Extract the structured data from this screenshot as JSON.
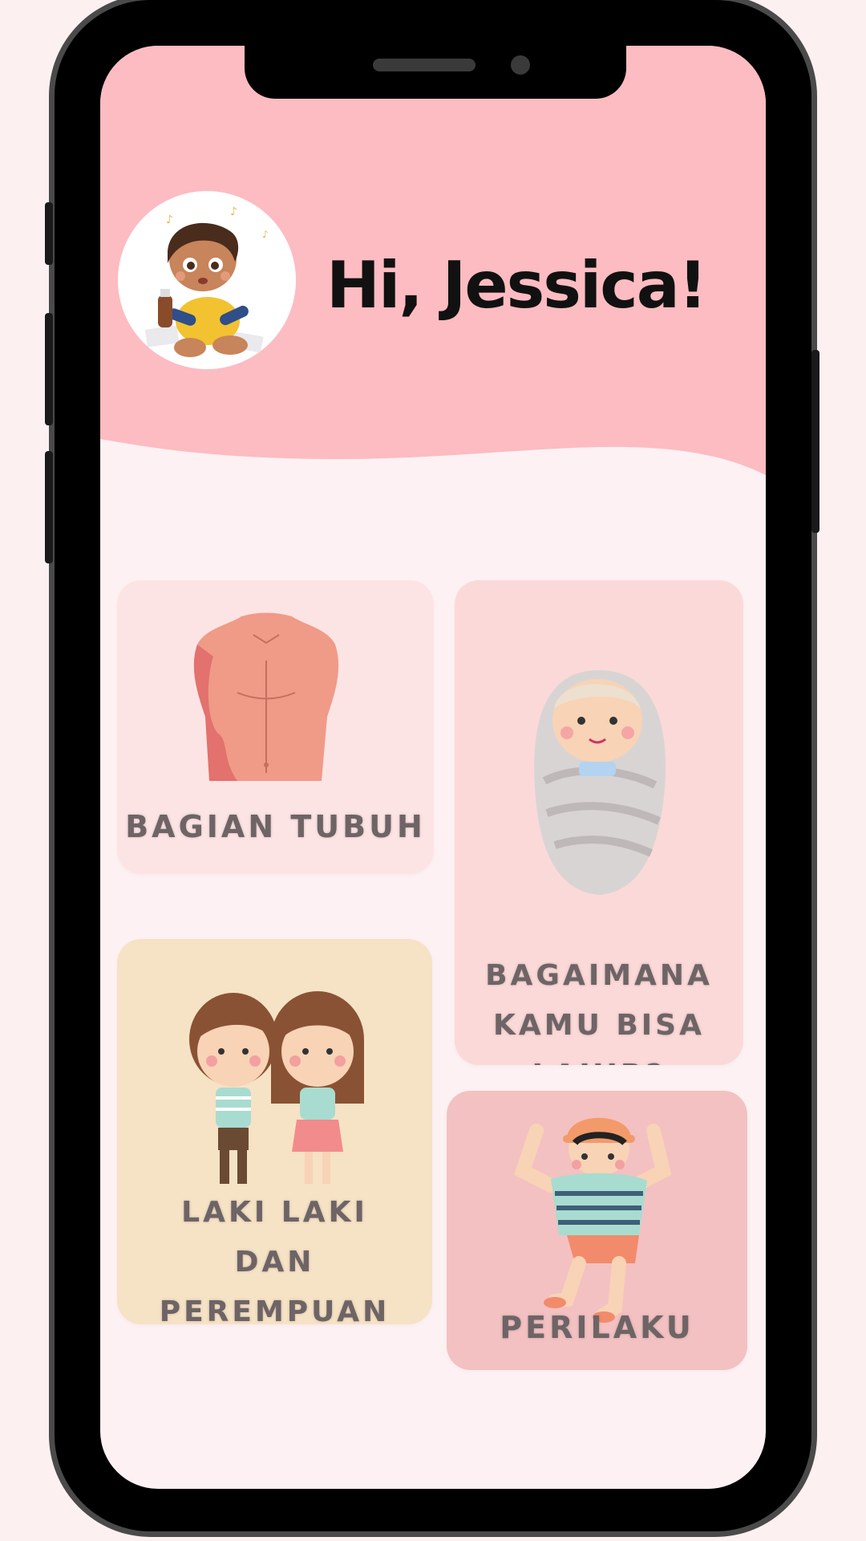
{
  "header": {
    "greeting": "Hi, Jessica!"
  },
  "cards": [
    {
      "label": "BAGIAN TUBUH",
      "icon": "torso-icon",
      "color": "#fde4e4"
    },
    {
      "label": "BAGAIMANA\nKAMU BISA\nLAHIR?",
      "icon": "swaddled-baby-icon",
      "color": "#fcd9d9"
    },
    {
      "label": "LAKI LAKI\nDAN\nPEREMPUAN",
      "icon": "boy-girl-icon",
      "color": "#f6e2c4"
    },
    {
      "label": "PERILAKU",
      "icon": "dancing-child-icon",
      "color": "#f3c1c1"
    }
  ],
  "colors": {
    "header_pink": "#fcbcc1",
    "background": "#fdf1f3",
    "label_gray": "#6e6466"
  }
}
